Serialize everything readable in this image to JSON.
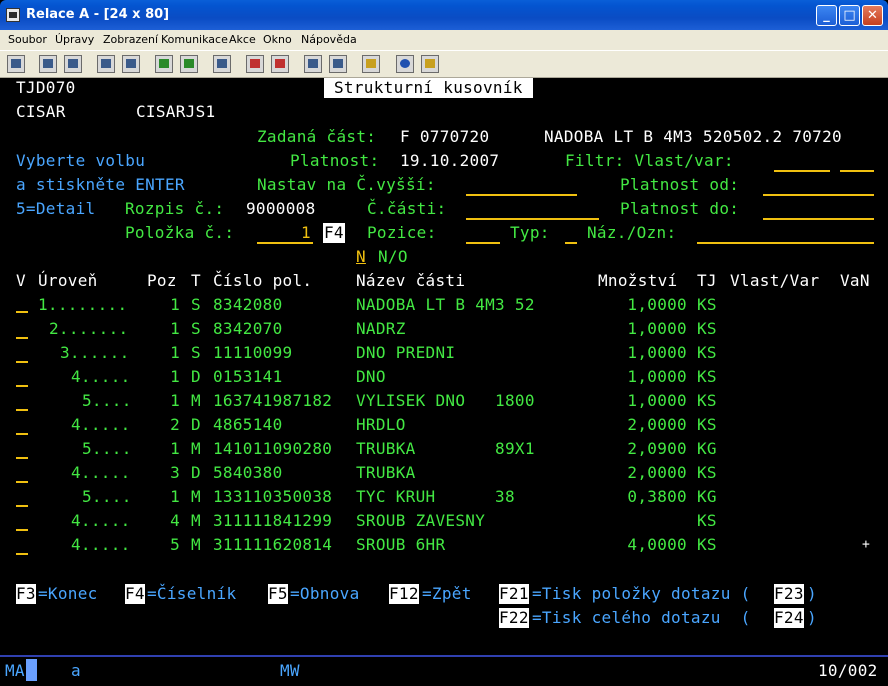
{
  "window": {
    "title": "Relace A - [24 x 80]",
    "icon": "terminal-icon"
  },
  "menu": [
    "Soubor",
    "Úpravy",
    "Zobrazení",
    "Komunikace",
    "Akce",
    "Okno",
    "Nápověda"
  ],
  "header": {
    "program_id": "TJD070",
    "screen_title": "Strukturní kusovník",
    "user": "CISAR",
    "session": "CISARJS1"
  },
  "form": {
    "zadana_cast_label": "Zadaná část:",
    "zadana_cast_value": "F 0770720",
    "zadana_cast_desc": "NADOBA LT B 4M3 520502.2 70720",
    "instruction1": "Vyberte volbu",
    "instruction2": "a stiskněte ENTER",
    "option_detail": "5=Detail",
    "platnost_label": "Platnost:",
    "platnost_value": "19.10.2007",
    "filtr_label": "Filtr: Vlast/var:",
    "nastav_label": "Nastav na Č.vyšší:",
    "platnost_od_label": "Platnost od:",
    "rozpis_label": "Rozpis č.:",
    "rozpis_value": "9000008",
    "cislo_casti_label": "Č.části:",
    "platnost_do_label": "Platnost do:",
    "polozka_label": "Položka č.:",
    "polozka_value": "1",
    "f4_hint": "F4",
    "pozice_label": "Pozice:",
    "typ_label": "Typ:",
    "naz_label": "Náz./Ozn:",
    "no_flag": "N",
    "no_label": "N/O"
  },
  "table": {
    "headers": {
      "v": "V",
      "uroven": "Úroveň",
      "poz": "Poz",
      "t": "T",
      "cislo": "Číslo pol.",
      "nazev": "Název části",
      "mnozstvi": "Množství",
      "tj": "TJ",
      "vlast": "Vlast/Var",
      "van": "VaN"
    },
    "rows": [
      {
        "level": "1........",
        "poz": "1",
        "t": "S",
        "cislo": "8342080",
        "nazev": "NADOBA LT B 4M3 52",
        "mnozstvi": "1,0000",
        "tj": "KS"
      },
      {
        "level": "2.......",
        "poz": "1",
        "t": "S",
        "cislo": "8342070",
        "nazev": "NADRZ",
        "mnozstvi": "1,0000",
        "tj": "KS"
      },
      {
        "level": "3......",
        "poz": "1",
        "t": "S",
        "cislo": "11110099",
        "nazev": "DNO PREDNI",
        "mnozstvi": "1,0000",
        "tj": "KS"
      },
      {
        "level": "4.....",
        "poz": "1",
        "t": "D",
        "cislo": "0153141",
        "nazev": "DNO",
        "mnozstvi": "1,0000",
        "tj": "KS"
      },
      {
        "level": "5....",
        "poz": "1",
        "t": "M",
        "cislo": "163741987182",
        "nazev": "VYLISEK DNO   1800",
        "mnozstvi": "1,0000",
        "tj": "KS"
      },
      {
        "level": "4.....",
        "poz": "2",
        "t": "D",
        "cislo": "4865140",
        "nazev": "HRDLO",
        "mnozstvi": "2,0000",
        "tj": "KS"
      },
      {
        "level": "5....",
        "poz": "1",
        "t": "M",
        "cislo": "141011090280",
        "nazev": "TRUBKA        89X1",
        "mnozstvi": "2,0900",
        "tj": "KG"
      },
      {
        "level": "4.....",
        "poz": "3",
        "t": "D",
        "cislo": "5840380",
        "nazev": "TRUBKA",
        "mnozstvi": "2,0000",
        "tj": "KS"
      },
      {
        "level": "5....",
        "poz": "1",
        "t": "M",
        "cislo": "133110350038",
        "nazev": "TYC KRUH      38",
        "mnozstvi": "0,3800",
        "tj": "KG"
      },
      {
        "level": "4.....",
        "poz": "4",
        "t": "M",
        "cislo": "311111841299",
        "nazev": "SROUB ZAVESNY",
        "mnozstvi": "",
        "tj": "KS"
      },
      {
        "level": "4.....",
        "poz": "5",
        "t": "M",
        "cislo": "311111620814",
        "nazev": "SROUB 6HR",
        "mnozstvi": "4,0000",
        "tj": "KS"
      }
    ],
    "more": "+"
  },
  "fkeys": {
    "f3": "F3",
    "f3_label": "=Konec",
    "f4": "F4",
    "f4_label": "=Číselník",
    "f5": "F5",
    "f5_label": "=Obnova",
    "f12": "F12",
    "f12_label": "=Zpět",
    "f21": "F21",
    "f21_label": "=Tisk položky dotazu (",
    "f23": "F23",
    "f23_close": ")",
    "f22": "F22",
    "f22_label": "=Tisk celého dotazu  (",
    "f24": "F24",
    "f24_close": ")"
  },
  "status": {
    "ma": "MA",
    "session": "a",
    "mode": "MW",
    "position": "10/002"
  },
  "colors": {
    "green": "#43e843",
    "cyan": "#4aa6ff",
    "yellow": "#f0c010",
    "white": "#ffffff",
    "background": "#000000"
  }
}
